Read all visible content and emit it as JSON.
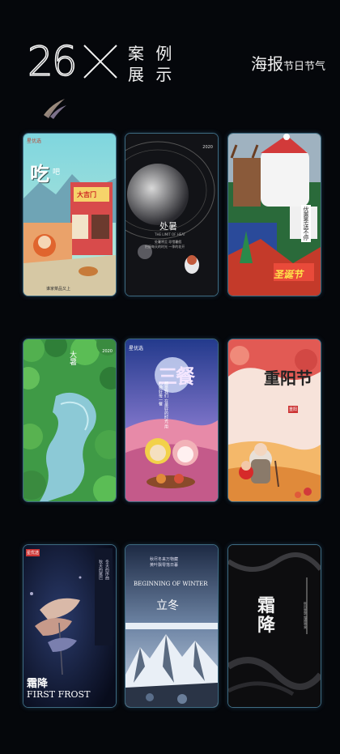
{
  "header": {
    "count": "26",
    "heading_line1": "案 例",
    "heading_line2": "展 示",
    "poster_title": "海报",
    "poster_sub": "节日节气"
  },
  "cards": [
    {
      "id": "chi",
      "logo": "星优选",
      "title": "吃",
      "sub": "吧",
      "shop": "大吉门",
      "caption": "谁家菜品又上"
    },
    {
      "id": "chushu",
      "year": "2020",
      "title": "处暑",
      "en": "THE LIMIT OF HEAT",
      "caption": "处暑将至 珍惜暑假",
      "caption2": "把握每天的时光 一季的花开"
    },
    {
      "id": "christmas",
      "title": "圣诞节",
      "slogan": "优惠季送不停"
    },
    {
      "id": "dashu",
      "year": "2020",
      "title": "大暑"
    },
    {
      "id": "sancan",
      "logo": "星优选",
      "title": "三餐",
      "caption": "都是我们 在最好的时光 用心做好每一餐"
    },
    {
      "id": "chongyang",
      "title": "重阳节",
      "stamp": "重阳"
    },
    {
      "id": "shuangjiang1",
      "logo": "星优选",
      "title": "霜降",
      "en": "FIRST FROST",
      "vert1": "秋天的尾巴",
      "vert2": "冬天的序曲"
    },
    {
      "id": "lidong",
      "caption": "秋尽冬来万物藏",
      "caption2": "黄叶飘零落日暮",
      "en": "BEGINNING OF WINTER",
      "title": "立冬"
    },
    {
      "id": "shuangjiang2",
      "title": "霜降",
      "vert": "秋风瑟瑟 霜降寒来"
    }
  ]
}
